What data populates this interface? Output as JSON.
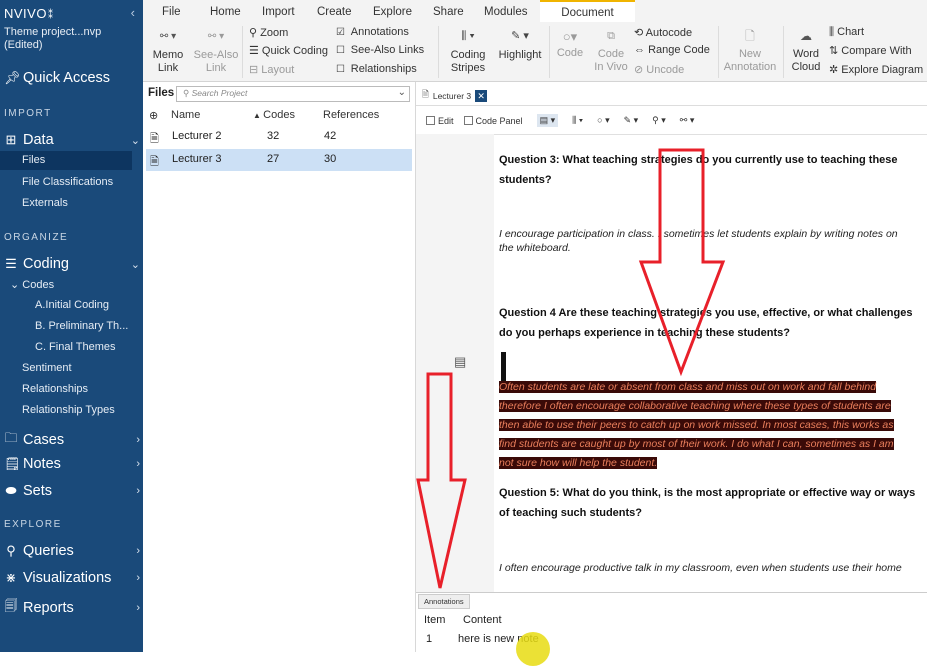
{
  "sidebar": {
    "logo": "NVIVO",
    "logo_mark": "⁑",
    "collapse_glyph": "‹",
    "project": "Theme project...nvp",
    "project_state": "(Edited)",
    "quick_access": "Quick Access",
    "sec_import": "IMPORT",
    "data": "Data",
    "files": "Files",
    "file_classifications": "File Classifications",
    "externals": "Externals",
    "sec_organize": "ORGANIZE",
    "coding": "Coding",
    "codes": "Codes",
    "code_a": "A.Initial Coding",
    "code_b": "B. Preliminary Th...",
    "code_c": "C. Final Themes",
    "sentiment": "Sentiment",
    "relationships": "Relationships",
    "relationship_types": "Relationship Types",
    "cases": "Cases",
    "notes": "Notes",
    "sets": "Sets",
    "sec_explore": "EXPLORE",
    "queries": "Queries",
    "visualizations": "Visualizations",
    "reports": "Reports"
  },
  "ribbon": {
    "tabs": [
      "File",
      "Home",
      "Import",
      "Create",
      "Explore",
      "Share",
      "Modules"
    ],
    "active_tab": "Document",
    "memo_link": [
      "Memo",
      "Link"
    ],
    "see_also_link": [
      "See-Also",
      "Link"
    ],
    "zoom": "Zoom",
    "quick_coding": "Quick Coding",
    "layout": "Layout",
    "annotations": "Annotations",
    "see_also_links": "See-Also Links",
    "relationships": "Relationships",
    "coding_stripes": [
      "Coding",
      "Stripes"
    ],
    "highlight": "Highlight",
    "code": "Code",
    "code_in_vivo": [
      "Code",
      "In Vivo"
    ],
    "autocode": "Autocode",
    "range_code": "Range Code",
    "uncode": "Uncode",
    "new_annotation": [
      "New",
      "Annotation"
    ],
    "word_cloud": [
      "Word",
      "Cloud"
    ],
    "chart": "Chart",
    "compare_with": "Compare With",
    "explore_diagram": "Explore Diagram"
  },
  "files_panel": {
    "title": "Files",
    "search_placeholder": "Search Project",
    "col_name": "Name",
    "col_codes": "Codes",
    "col_refs": "References",
    "rows": [
      {
        "name": "Lecturer 2",
        "codes": "32",
        "refs": "42"
      },
      {
        "name": "Lecturer 3",
        "codes": "27",
        "refs": "30"
      }
    ]
  },
  "document": {
    "tab_title": "Lecturer 3",
    "edit": "Edit",
    "code_panel": "Code Panel",
    "q3_line1": "Question 3: What teaching strategies do you currently use to teaching these",
    "q3_line2": "students?",
    "a3_line1": "I encourage participation in class. I sometimes let students explain by writing notes on",
    "a3_line2": "the whiteboard.",
    "q4_line1": "Question 4  Are these teaching strategies you use, effective, or what challenges",
    "q4_line2": "do you perhaps experience in teaching these students?",
    "hl_lines": [
      "Often students are late or absent from class and miss out on work and fall behind",
      "therefore I often encourage collaborative teaching where these types of students are",
      "then able to use their peers to catch up on work missed. In most cases, this works as",
      "find students are caught up by most of their work. I do what I can, sometimes as I am",
      "not sure how will help the student."
    ],
    "q5_line1": "Question 5:  What do you think, is the most appropriate or effective way or ways",
    "q5_line2": "of teaching such students?",
    "a5_line1": "I often encourage productive talk in my classroom, even when students use their home"
  },
  "annotations": {
    "tab": "Annotations",
    "col_item": "Item",
    "col_content": "Content",
    "item": "1",
    "content": "here is new note"
  },
  "colors": {
    "sidebar": "#1a4a7a",
    "accent_tab": "#f0b400",
    "highlight_bg": "#3a0a08",
    "highlight_text": "#ea7f5c",
    "arrow": "#e8202a"
  }
}
